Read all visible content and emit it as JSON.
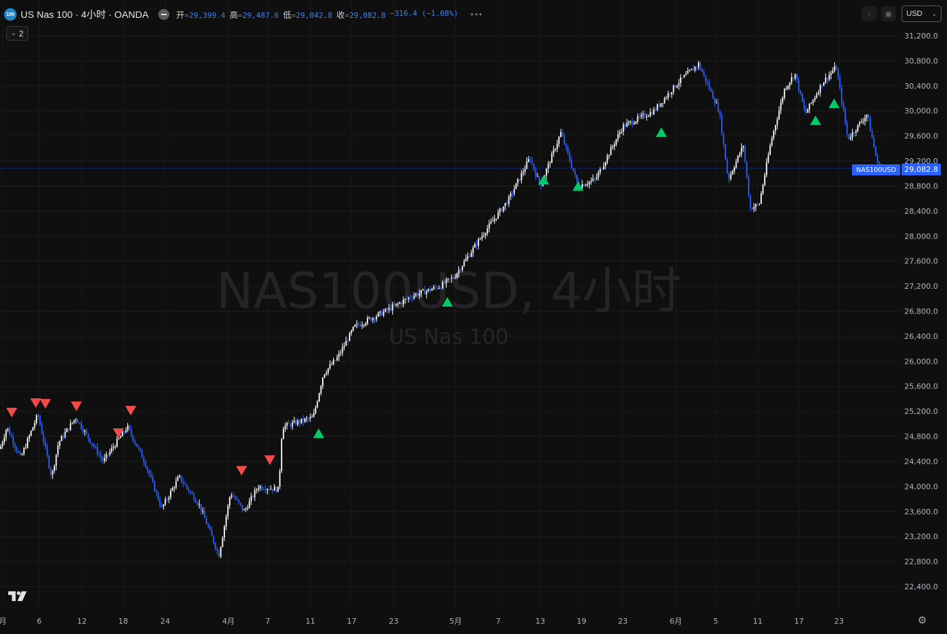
{
  "header": {
    "logo_text": "100",
    "symbol_title": "US Nas 100 · 4小时 · OANDA",
    "ohlc": [
      {
        "label": "开",
        "value": "=29,399.4"
      },
      {
        "label": "高",
        "value": "=29,487.6"
      },
      {
        "label": "低",
        "value": "=29,042.8"
      },
      {
        "label": "收",
        "value": "=29,082.8"
      }
    ],
    "change": "−316.4 (−1.08%)",
    "more_icon": "more-dots-icon"
  },
  "collapse_count": "2",
  "currency": "USD",
  "watermark": {
    "line1": "NAS100USD, 4小时",
    "line2": "US Nas 100"
  },
  "last_price": {
    "symbol_tag": "NAS100USD",
    "price_label": "29,082.8",
    "value": 29082.8
  },
  "colors": {
    "background": "#0f0f0f",
    "up_candle": "#ffffff",
    "down_candle": "#2962ff",
    "buy_signal": "#00c96a",
    "sell_signal": "#f54a4a",
    "price_tag": "#2962ff",
    "ohlc_values": "#3b82f6"
  },
  "chart_data": {
    "type": "candlestick",
    "y_axis": {
      "min": 22000,
      "max": 31400,
      "ticks": [
        "31,200.0",
        "30,800.0",
        "30,400.0",
        "30,000.0",
        "29,600.0",
        "29,200.0",
        "28,800.0",
        "28,400.0",
        "28,000.0",
        "27,600.0",
        "27,200.0",
        "26,800.0",
        "26,400.0",
        "26,000.0",
        "25,600.0",
        "25,200.0",
        "24,800.0",
        "24,400.0",
        "24,000.0",
        "23,600.0",
        "23,200.0",
        "22,800.0",
        "22,400.0"
      ]
    },
    "x_axis": {
      "labels": [
        "月",
        "6",
        "12",
        "18",
        "24",
        "4月",
        "7",
        "11",
        "17",
        "23",
        "5月",
        "7",
        "13",
        "19",
        "23",
        "6月",
        "5",
        "11",
        "17",
        "23"
      ]
    },
    "price_path": [
      [
        0,
        24600
      ],
      [
        10,
        24950
      ],
      [
        30,
        24450
      ],
      [
        55,
        25150
      ],
      [
        75,
        24150
      ],
      [
        85,
        24700
      ],
      [
        110,
        25100
      ],
      [
        150,
        24400
      ],
      [
        185,
        24950
      ],
      [
        210,
        24400
      ],
      [
        235,
        23650
      ],
      [
        260,
        24150
      ],
      [
        290,
        23700
      ],
      [
        318,
        22900
      ],
      [
        335,
        23900
      ],
      [
        355,
        23600
      ],
      [
        375,
        24000
      ],
      [
        405,
        23950
      ],
      [
        410,
        24950
      ],
      [
        455,
        25100
      ],
      [
        470,
        25800
      ],
      [
        490,
        26050
      ],
      [
        515,
        26550
      ],
      [
        560,
        26800
      ],
      [
        600,
        27050
      ],
      [
        640,
        27200
      ],
      [
        660,
        27350
      ],
      [
        700,
        28000
      ],
      [
        740,
        28600
      ],
      [
        770,
        29250
      ],
      [
        785,
        28800
      ],
      [
        815,
        29650
      ],
      [
        840,
        28800
      ],
      [
        865,
        28900
      ],
      [
        905,
        29750
      ],
      [
        950,
        30000
      ],
      [
        985,
        30450
      ],
      [
        1015,
        30750
      ],
      [
        1045,
        30000
      ],
      [
        1058,
        28900
      ],
      [
        1080,
        29450
      ],
      [
        1090,
        28450
      ],
      [
        1103,
        28500
      ],
      [
        1120,
        29500
      ],
      [
        1140,
        30350
      ],
      [
        1155,
        30600
      ],
      [
        1170,
        29950
      ],
      [
        1195,
        30450
      ],
      [
        1215,
        30700
      ],
      [
        1232,
        29550
      ],
      [
        1260,
        29950
      ],
      [
        1275,
        29150
      ],
      [
        1282,
        29080
      ]
    ],
    "signals": {
      "sell": [
        {
          "x_label": "6",
          "price": 25180
        },
        {
          "x_label": "6",
          "price": 25330
        },
        {
          "x_label": "6",
          "price": 25320
        },
        {
          "x_label": "12",
          "price": 25280
        },
        {
          "x_label": "18",
          "price": 24850
        },
        {
          "x_label": "18",
          "price": 25210
        },
        {
          "x_label": "4月",
          "price": 24250
        },
        {
          "x_label": "7",
          "price": 24420
        }
      ],
      "buy": [
        {
          "x_label": "11",
          "price": 24850
        },
        {
          "x_label": "5月",
          "price": 26950
        },
        {
          "x_label": "13",
          "price": 28900
        },
        {
          "x_label": "19",
          "price": 28800
        },
        {
          "x_label": "23",
          "price": 29660
        },
        {
          "x_label": "17",
          "price": 29850
        },
        {
          "x_label": "23",
          "price": 30120
        }
      ]
    }
  }
}
